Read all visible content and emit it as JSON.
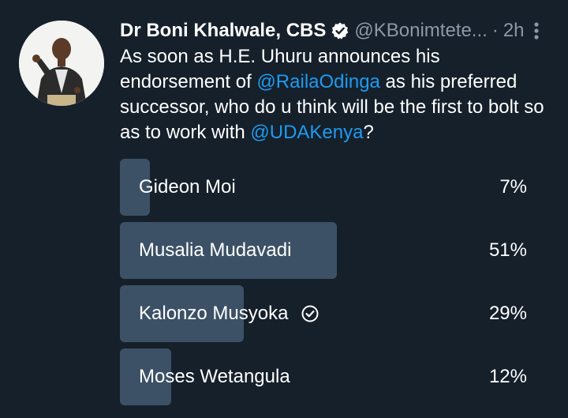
{
  "tweet": {
    "author": "Dr Boni Khalwale, CBS",
    "handle": "@KBonimtete...",
    "separator": "·",
    "time": "2h",
    "text": {
      "part1": "As soon as H.E. Uhuru announces his endorsement of ",
      "mention1": "@RailaOdinga",
      "part2": " as his preferred successor, who do u think will be the first to bolt so as to work with ",
      "mention2": "@UDAKenya",
      "part3": "?"
    }
  },
  "poll": {
    "options": [
      {
        "label": "Gideon Moi",
        "percent_text": "7%",
        "percent": 7,
        "selected": false
      },
      {
        "label": "Musalia Mudavadi",
        "percent_text": "51%",
        "percent": 51,
        "selected": false
      },
      {
        "label": "Kalonzo Musyoka",
        "percent_text": "29%",
        "percent": 29,
        "selected": true
      },
      {
        "label": "Moses Wetangula",
        "percent_text": "12%",
        "percent": 12,
        "selected": false
      }
    ]
  },
  "icons": {
    "verified": "verified-badge-icon",
    "more": "more-vertical-icon",
    "selected": "check-circle-icon"
  },
  "colors": {
    "background": "#15202b",
    "bar": "#3c5166",
    "mention": "#1d9bf0",
    "secondary_text": "#8b98a5"
  }
}
